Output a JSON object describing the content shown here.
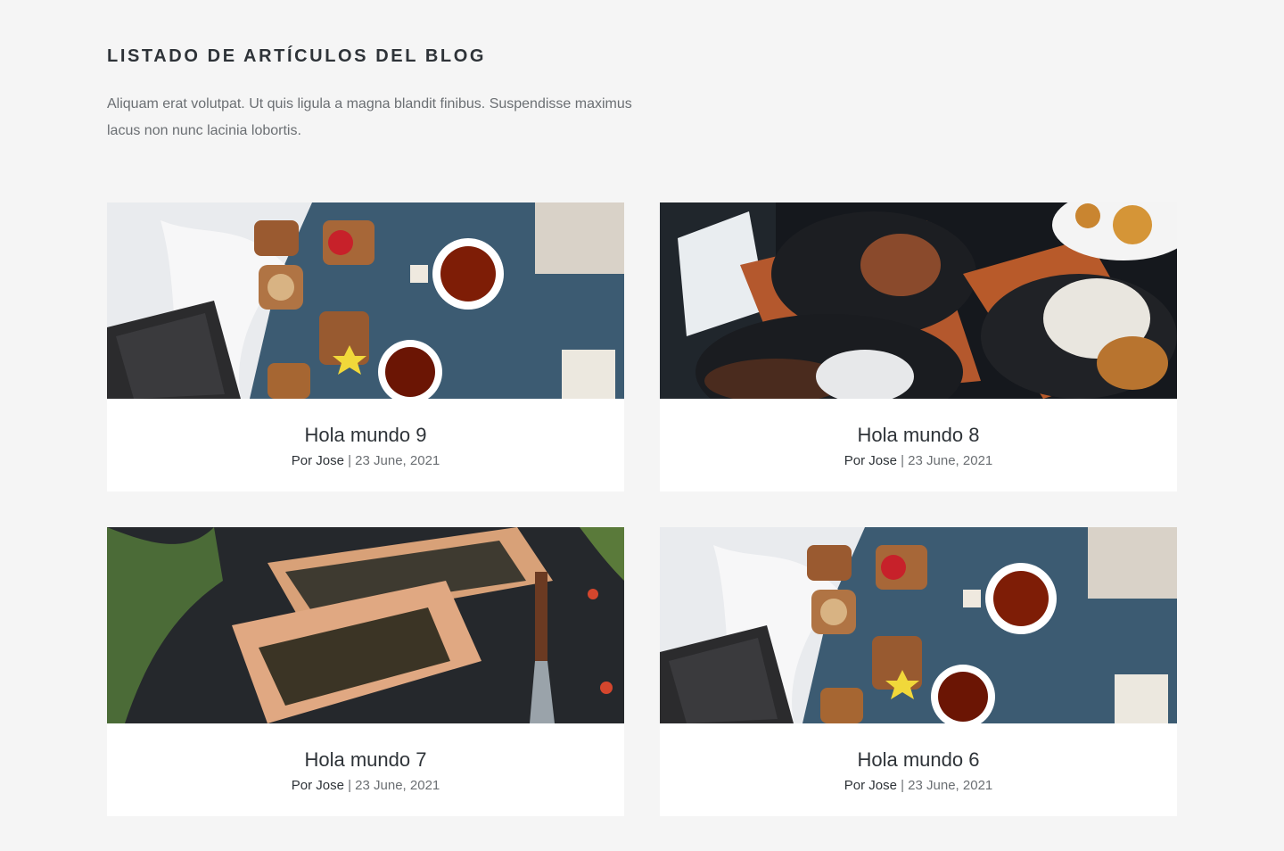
{
  "section": {
    "title": "LISTADO DE ARTÍCULOS DEL BLOG",
    "intro": "Aliquam erat volutpat. Ut quis ligula a magna blandit finibus. Suspendisse maximus lacus non nunc lacinia lobortis."
  },
  "posts": [
    {
      "title": "Hola mundo 9",
      "author_prefix": "Por",
      "author": "Jose",
      "separator": "|",
      "date": "23 June, 2021",
      "image": "breakfast-tea-photo"
    },
    {
      "title": "Hola mundo 8",
      "author_prefix": "Por",
      "author": "Jose",
      "separator": "|",
      "date": "23 June, 2021",
      "image": "grilled-dishes-photo"
    },
    {
      "title": "Hola mundo 7",
      "author_prefix": "Por",
      "author": "Jose",
      "separator": "|",
      "date": "23 June, 2021",
      "image": "sushi-board-photo"
    },
    {
      "title": "Hola mundo 6",
      "author_prefix": "Por",
      "author": "Jose",
      "separator": "|",
      "date": "23 June, 2021",
      "image": "breakfast-tea-photo"
    }
  ],
  "colors": {
    "background": "#f5f5f5",
    "card": "#ffffff",
    "heading": "#2e3338",
    "text": "#6b6f73"
  }
}
